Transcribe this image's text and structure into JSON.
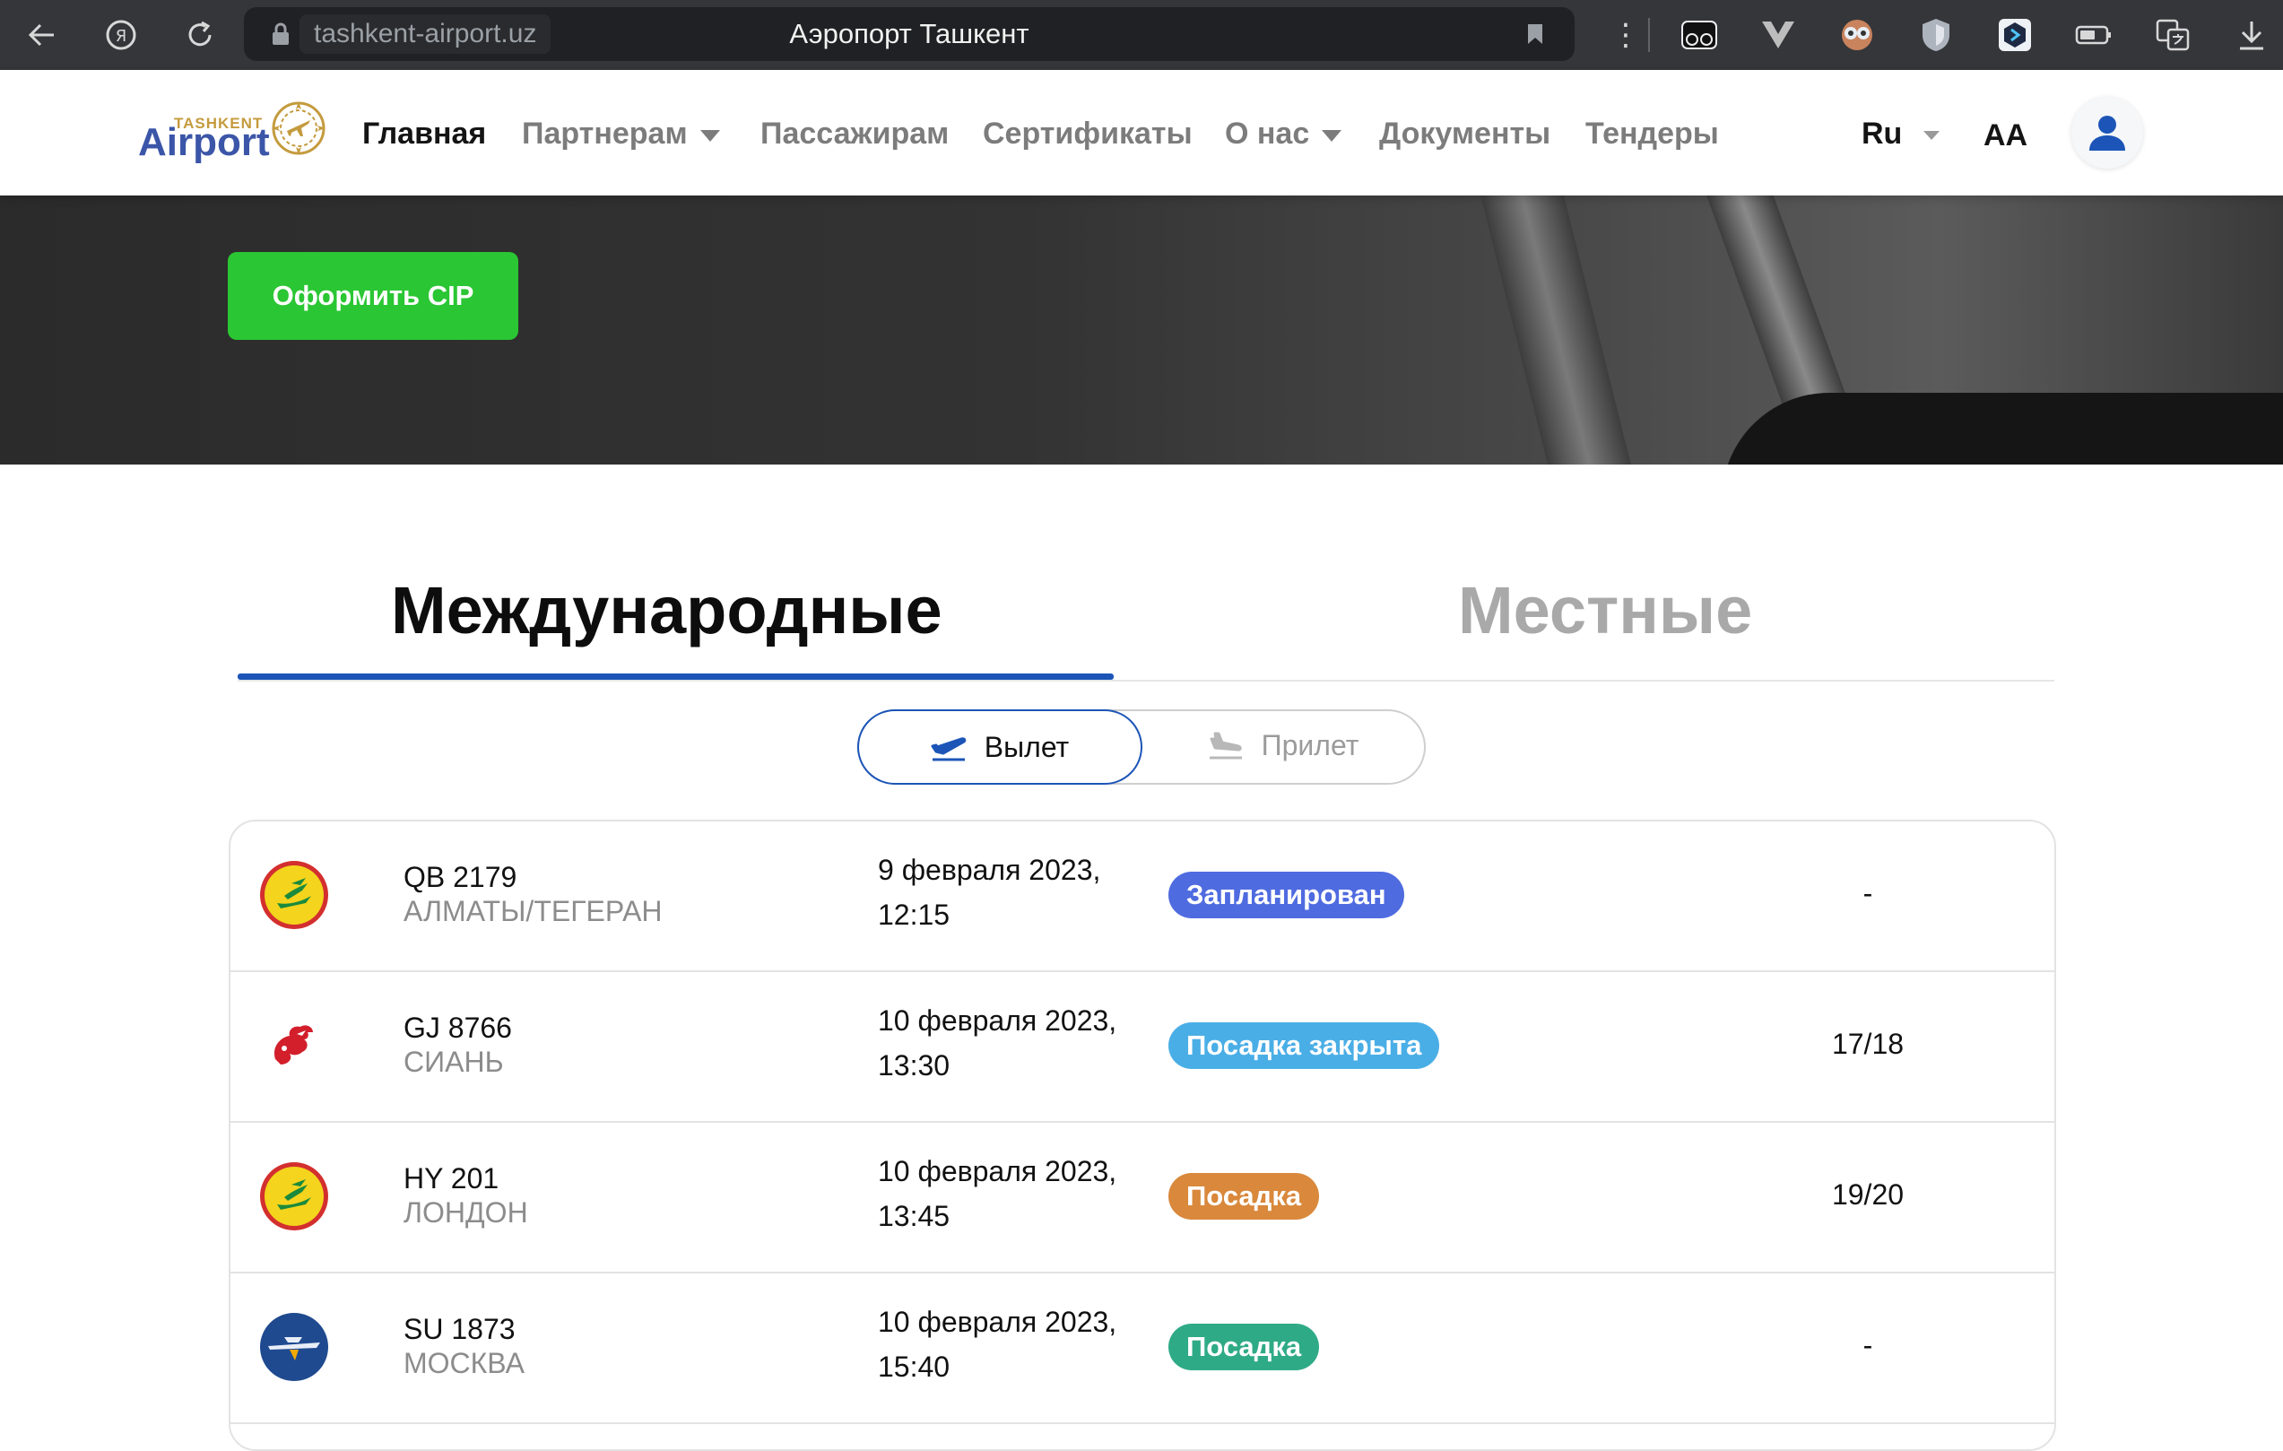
{
  "browser": {
    "domain": "tashkent-airport.uz",
    "tab_title": "Аэропорт Ташкент",
    "kebab": "⋮"
  },
  "site": {
    "logo_small": "TASHKENT",
    "logo_big": "Airport",
    "nav": [
      {
        "label": "Главная"
      },
      {
        "label": "Партнерам"
      },
      {
        "label": "Пассажирам"
      },
      {
        "label": "Сертификаты"
      },
      {
        "label": "О нас"
      },
      {
        "label": "Документы"
      },
      {
        "label": "Тендеры"
      }
    ],
    "language": "Ru",
    "font_size_label": "AA"
  },
  "hero": {
    "cip_button": "Оформить CIP"
  },
  "tabs": {
    "international": "Международные",
    "local": "Местные"
  },
  "toggle": {
    "departure": "Вылет",
    "arrival": "Прилет"
  },
  "flights": [
    {
      "code": "QB 2179",
      "city": "АЛМАТЫ/ТЕГЕРАН",
      "date": "9 февраля 2023,",
      "time": "12:15",
      "status": "Запланирован",
      "status_color": "#4f6be0",
      "gate": "-",
      "airline_logo": "uzbekistan-airways-logo"
    },
    {
      "code": "GJ 8766",
      "city": "СИАНЬ",
      "date": "10 февраля 2023,",
      "time": "13:30",
      "status": "Посадка закрыта",
      "status_color": "#4aaee6",
      "gate": "17/18",
      "airline_logo": "red-dragon-logo"
    },
    {
      "code": "HY 201",
      "city": "ЛОНДОН",
      "date": "10 февраля 2023,",
      "time": "13:45",
      "status": "Посадка",
      "status_color": "#d9883c",
      "gate": "19/20",
      "airline_logo": "uzbekistan-airways-logo"
    },
    {
      "code": "SU 1873",
      "city": "МОСКВА",
      "date": "10 февраля 2023,",
      "time": "15:40",
      "status": "Посадка",
      "status_color": "#2faa87",
      "gate": "-",
      "airline_logo": "aeroflot-logo"
    }
  ],
  "colors": {
    "accent_blue": "#1c55b7",
    "cip_green": "#2ac633"
  }
}
